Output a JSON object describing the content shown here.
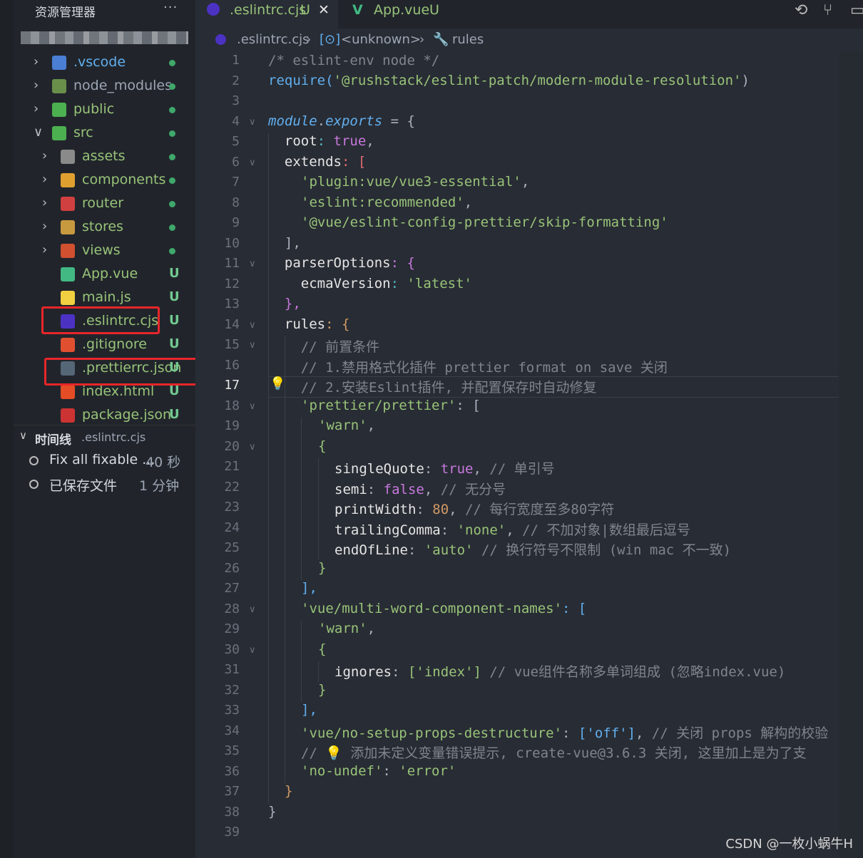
{
  "sidebar": {
    "title": "资源管理器",
    "more": "···",
    "tree": [
      {
        "label": ".vscode",
        "type": "folder",
        "status": "dot",
        "color": "#61afef"
      },
      {
        "label": "node_modules",
        "type": "folder",
        "status": "dot",
        "color": "#9da5b4"
      },
      {
        "label": "public",
        "type": "folder",
        "status": "dot",
        "color": "#98c379"
      },
      {
        "label": "src",
        "type": "folder",
        "status": "dot",
        "color": "#98c379",
        "expanded": true
      },
      {
        "label": "assets",
        "type": "folder",
        "status": "dot",
        "color": "#98c379"
      },
      {
        "label": "components",
        "type": "folder",
        "status": "dot",
        "color": "#98c379"
      },
      {
        "label": "router",
        "type": "folder",
        "status": "dot",
        "color": "#98c379"
      },
      {
        "label": "stores",
        "type": "folder",
        "status": "dot",
        "color": "#98c379"
      },
      {
        "label": "views",
        "type": "folder",
        "status": "dot",
        "color": "#98c379"
      },
      {
        "label": "App.vue",
        "type": "file",
        "status": "U",
        "color": "#98c379"
      },
      {
        "label": "main.js",
        "type": "file",
        "status": "U",
        "color": "#98c379"
      },
      {
        "label": ".eslintrc.cjs",
        "type": "file",
        "status": "U",
        "color": "#98c379"
      },
      {
        "label": ".gitignore",
        "type": "file",
        "status": "U",
        "color": "#98c379"
      },
      {
        "label": ".prettierrc.json",
        "type": "file",
        "status": "U",
        "color": "#98c379"
      },
      {
        "label": "index.html",
        "type": "file",
        "status": "U",
        "color": "#98c379"
      },
      {
        "label": "package.json",
        "type": "file",
        "status": "U",
        "color": "#98c379"
      }
    ],
    "timeline": {
      "title": "时间线",
      "file": ".eslintrc.cjs",
      "items": [
        {
          "label": "Fix all fixable ...",
          "time": "40 秒"
        },
        {
          "label": "已保存文件",
          "time": "1 分钟"
        }
      ]
    }
  },
  "tabs": [
    {
      "label": ".eslintrc.cjs",
      "status": "U",
      "close": "✕"
    },
    {
      "label": "App.vue",
      "status": "U"
    }
  ],
  "breadcrumb": [
    ".eslintrc.cjs",
    "<unknown>",
    "rules"
  ],
  "active_line": "17",
  "code": [
    "1",
    "2",
    "3",
    "4",
    "5",
    "6",
    "7",
    "8",
    "9",
    "10",
    "11",
    "12",
    "13",
    "14",
    "15",
    "16",
    "17",
    "18",
    "19",
    "20",
    "21",
    "22",
    "23",
    "24",
    "25",
    "26",
    "27",
    "28",
    "29",
    "30",
    "31",
    "32",
    "33",
    "34",
    "35",
    "36",
    "37",
    "38",
    "39"
  ],
  "code_text": {
    "l1": "/* eslint-env node */",
    "l2a": "require(",
    "l2b": "'@rushstack/eslint-patch/modern-module-resolution'",
    "l2c": ")",
    "l4a": "module",
    "l4b": ".",
    "l4c": "exports",
    "l4d": " = {",
    "l5a": "  root",
    "l5b": ": ",
    "l5c": "true",
    "l5d": ",",
    "l6a": "  extends",
    "l6b": ": [",
    "l7": "'plugin:vue/vue3-essential'",
    "l8": "'eslint:recommended'",
    "l9": "'@vue/eslint-config-prettier/skip-formatting'",
    "l10": "  ],",
    "l11a": "  parserOptions",
    "l11b": ": {",
    "l12a": "    ecmaVersion",
    "l12b": ": ",
    "l12c": "'latest'",
    "l13": "  },",
    "l14a": "  rules",
    "l14b": ": {",
    "l15": "    // 前置条件",
    "l16": "    // 1.禁用格式化插件 prettier format on save 关闭",
    "l17": "    // 2.安装Eslint插件, 并配置保存时自动修复",
    "l18a": "'prettier/prettier'",
    "l18b": ": [",
    "l19": "'warn'",
    "l20": "{",
    "l21a": "singleQuote",
    "l21b": "true",
    "l21c": "// 单引号",
    "l22a": "semi",
    "l22b": "false",
    "l22c": "// 无分号",
    "l23a": "printWidth",
    "l23b": "80",
    "l23c": "// 每行宽度至多80字符",
    "l24a": "trailingComma",
    "l24b": "'none'",
    "l24c": "// 不加对象|数组最后逗号",
    "l25a": "endOfLine",
    "l25b": "'auto'",
    "l25c": "// 换行符号不限制 (win mac 不一致)",
    "l26": "}",
    "l27": "],",
    "l28a": "'vue/multi-word-component-names'",
    "l28b": ": [",
    "l29": "'warn'",
    "l30": "{",
    "l31a": "ignores",
    "l31b": "['index']",
    "l31c": "// vue组件名称多单词组成 (忽略index.vue)",
    "l32": "}",
    "l33": "],",
    "l34a": "'vue/no-setup-props-destructure'",
    "l34b": "['off']",
    "l34c": "// 关闭 props 解构的校验",
    "l35": "// 💡 添加未定义变量错误提示, create-vue@3.6.3 关闭, 这里加上是为了支",
    "l36a": "'no-undef'",
    "l36b": "'error'",
    "l37": "}",
    "l38": "}"
  },
  "watermark": "CSDN @一枚小蜗牛H",
  "colors": {
    "accent": "#528bff",
    "highlight_box": "#e8262a",
    "untracked": "#73c991"
  }
}
